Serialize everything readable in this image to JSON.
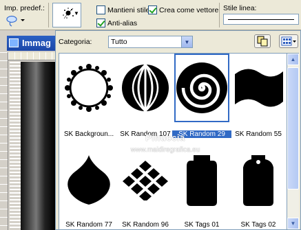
{
  "toolbar": {
    "preset_label": "Imp. predef.:",
    "mantieni_stile": "Mantieni stile",
    "crea_vettore": "Crea come vettore",
    "anti_alias": "Anti-alias",
    "stile_linea": "Stile linea:",
    "mantieni_checked": false,
    "crea_checked": true,
    "anti_alias_checked": true
  },
  "image_window": {
    "title": "Immag"
  },
  "picker": {
    "category_label": "Categoria:",
    "category_value": "Tutto",
    "selected_index": 2,
    "items": [
      {
        "label": "SK Backgroun...",
        "icon": "sun-ring-shape-icon"
      },
      {
        "label": "SK Random 107",
        "icon": "striped-sphere-shape-icon"
      },
      {
        "label": "SK Random 29",
        "icon": "spiral-shape-icon"
      },
      {
        "label": "SK Random 55",
        "icon": "wave-flag-shape-icon"
      },
      {
        "label": "SK Random 77",
        "icon": "onion-dome-shape-icon"
      },
      {
        "label": "SK Random 96",
        "icon": "diamond-grid-shape-icon"
      },
      {
        "label": "SK Tags 01",
        "icon": "jar-tag-shape-icon"
      },
      {
        "label": "SK Tags 02",
        "icon": "tag-shape-icon"
      }
    ]
  },
  "watermark": {
    "line1": "Pinuccia",
    "line2": "www.maidiregrafica.eu"
  }
}
